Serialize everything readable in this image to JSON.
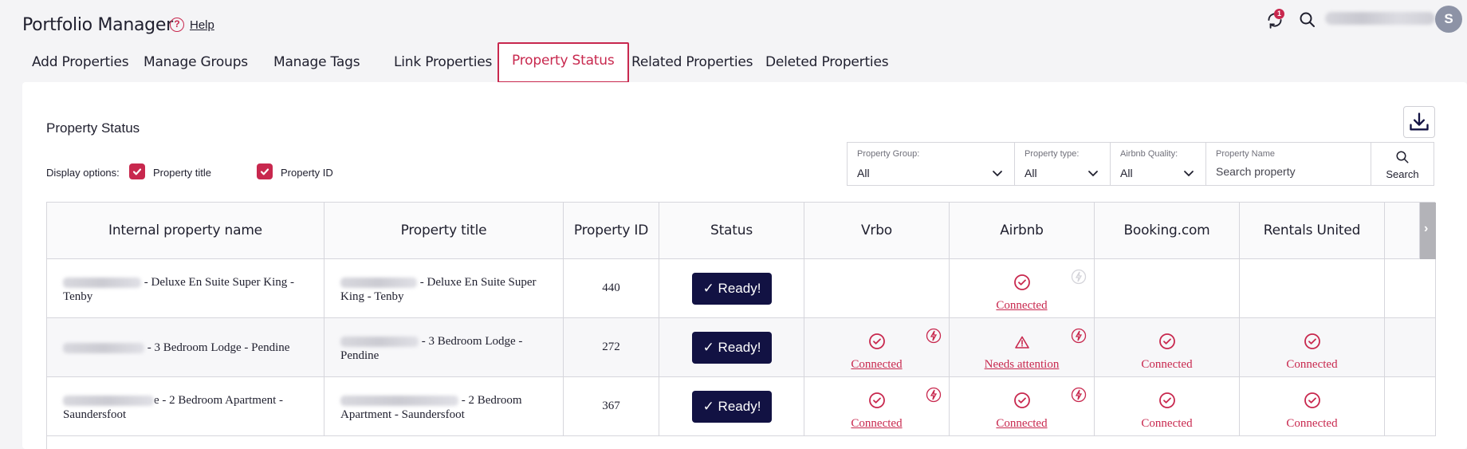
{
  "app": {
    "title": "Portfolio Manager",
    "help_label": "Help",
    "notification_count": "1",
    "avatar_initial": "S"
  },
  "tabs": [
    {
      "label": "Add Properties"
    },
    {
      "label": "Manage Groups"
    },
    {
      "label": "Manage Tags"
    },
    {
      "label": "Link Properties"
    },
    {
      "label": "Property Status",
      "active": true
    },
    {
      "label": "Related Properties"
    },
    {
      "label": "Deleted Properties"
    }
  ],
  "section": {
    "title": "Property Status"
  },
  "display_options": {
    "label": "Display options:",
    "property_title": "Property title",
    "property_id": "Property ID"
  },
  "filters": {
    "property_group": {
      "label": "Property Group:",
      "value": "All"
    },
    "property_type": {
      "label": "Property type:",
      "value": "All"
    },
    "airbnb_quality": {
      "label": "Airbnb Quality:",
      "value": "All"
    },
    "property_name": {
      "label": "Property Name",
      "placeholder": "Search property"
    },
    "search_label": "Search"
  },
  "table": {
    "columns": [
      "Internal property name",
      "Property title",
      "Property ID",
      "Status",
      "Vrbo",
      "Airbnb",
      "Booking.com",
      "Rentals United"
    ],
    "rows": [
      {
        "internal_name_l1": "- Deluxe En Suite Super King -",
        "internal_name_l2": "Tenby",
        "title_l1": "- Deluxe En Suite Super",
        "title_l2": "King - Tenby",
        "id": "440",
        "status": "Ready!",
        "vrbo": "",
        "airbnb": "Connected",
        "booking": "",
        "rentals": ""
      },
      {
        "internal_name_l1": "- 3 Bedroom Lodge - Pendine",
        "internal_name_l2": "",
        "title_l1": "- 3 Bedroom Lodge -",
        "title_l2": "Pendine",
        "id": "272",
        "status": "Ready!",
        "vrbo": "Connected",
        "airbnb": "Needs attention",
        "booking": "Connected",
        "rentals": "Connected"
      },
      {
        "internal_name_l1": "e - 2 Bedroom Apartment -",
        "internal_name_l2": "Saundersfoot",
        "title_l1": "- 2 Bedroom",
        "title_l2": "Apartment - Saundersfoot",
        "id": "367",
        "status": "Ready!",
        "vrbo": "Connected",
        "airbnb": "Connected",
        "booking": "Connected",
        "rentals": "Connected"
      }
    ]
  },
  "colors": {
    "accent": "#c8284e",
    "ready_bg": "#121243"
  },
  "icons": [
    "help-circle-icon",
    "sync-icon",
    "search-icon",
    "download-icon",
    "check-icon",
    "chevron-down-icon",
    "chevron-right-icon",
    "check-circle-icon",
    "warning-icon",
    "bolt-icon"
  ]
}
